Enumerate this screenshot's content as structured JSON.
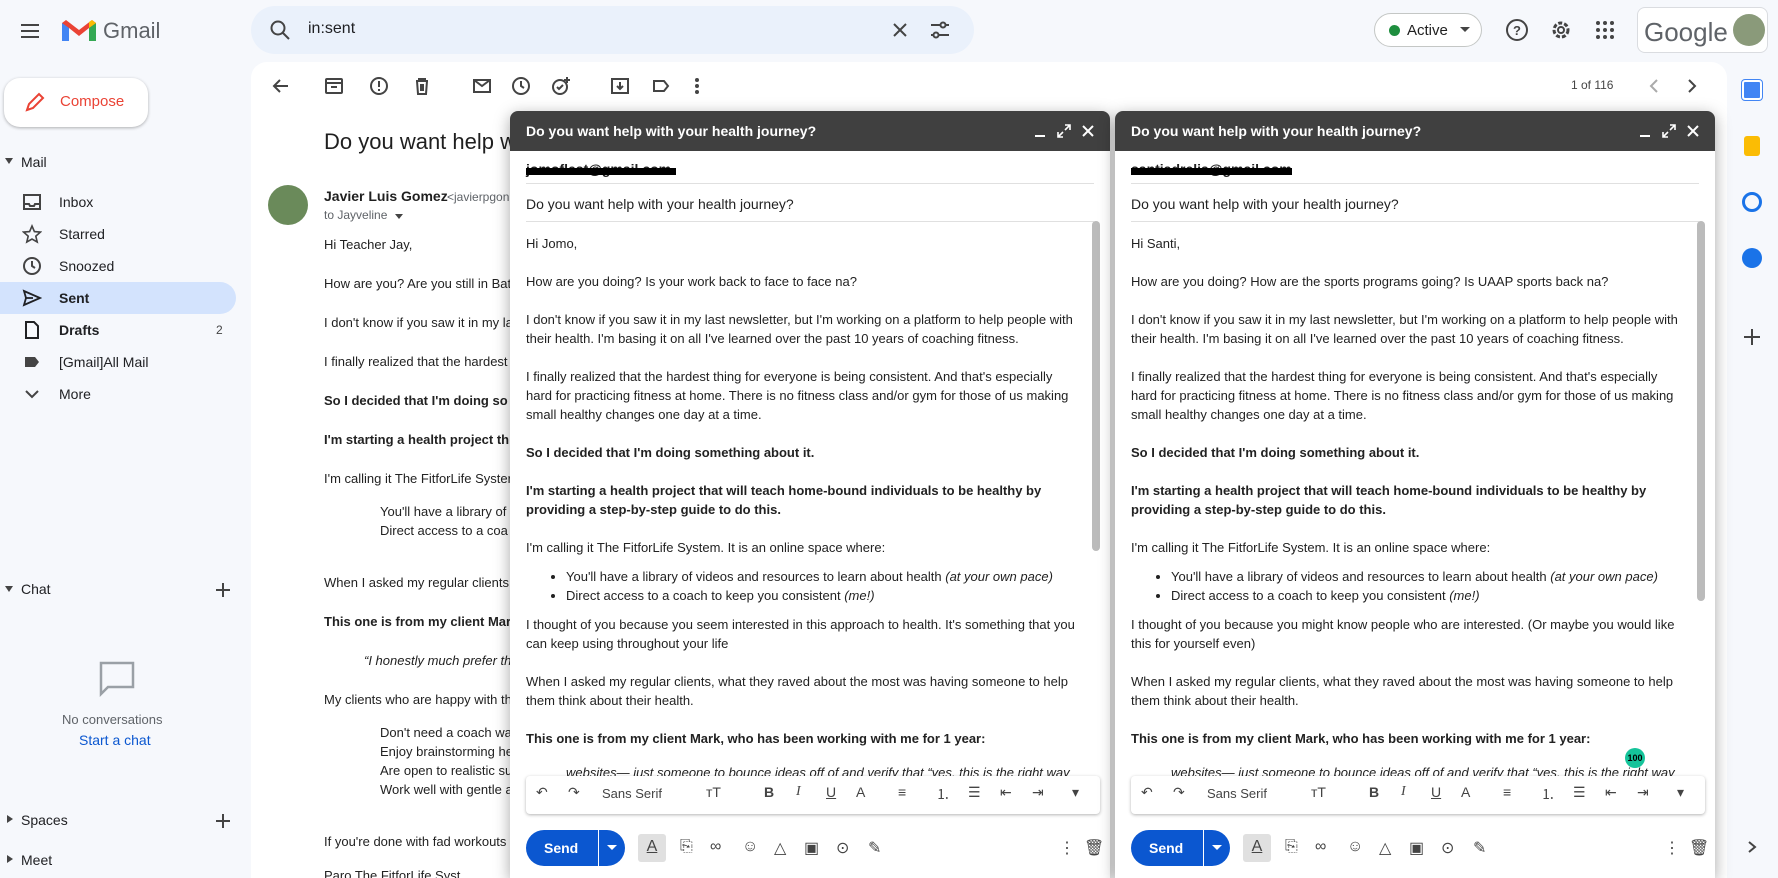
{
  "app": {
    "logo_text": "Gmail",
    "google_text": "Google"
  },
  "search": {
    "query": "in:sent"
  },
  "status": {
    "label": "Active"
  },
  "compose_button": {
    "label": "Compose"
  },
  "sidebar": {
    "mail_section": "Mail",
    "items": [
      {
        "label": "Inbox",
        "count": ""
      },
      {
        "label": "Starred",
        "count": ""
      },
      {
        "label": "Snoozed",
        "count": ""
      },
      {
        "label": "Sent",
        "count": ""
      },
      {
        "label": "Drafts",
        "count": "2"
      },
      {
        "label": "[Gmail]All Mail",
        "count": ""
      },
      {
        "label": "More",
        "count": ""
      }
    ],
    "chat_section": "Chat",
    "no_conversations": "No conversations",
    "start_chat": "Start a chat",
    "spaces_section": "Spaces",
    "meet_section": "Meet"
  },
  "pager": {
    "text": "1 of 116"
  },
  "thread": {
    "subject": "Do you want help w",
    "sender_name": "Javier Luis Gomez",
    "sender_email": "<javierpgon",
    "to_line": "to Jayveline",
    "lines": [
      "Hi Teacher Jay,",
      "How are you? Are you still in Bat",
      "I don't know if you saw it in my la",
      "I finally realized that the hardest",
      "So I decided that I'm doing so",
      "I'm starting a health project th",
      "I'm calling it The FitforLife Syster",
      "You'll have a library of",
      "Direct access to a coa",
      "When I asked my regular clients",
      "This one is from my client Mar",
      "“I honestly much prefer th",
      "My clients who are happy with th",
      "Don't need a coach wa",
      "Enjoy brainstorming he",
      "Are open to realistic su",
      "Work well with gentle a",
      "If you're done with fad workouts",
      "Paro The FitforLife Syst"
    ]
  },
  "compose_left": {
    "title": "Do you want help with your health journey?",
    "to": "jomoflest@gmail.com",
    "subject": "Do you want help with your health journey?",
    "greeting": "Hi Jomo,",
    "p1": "How are you doing? Is your work back to face to face na?",
    "p2a": "I don't know if you saw it in my last newsletter, but I'm working on a platform to help people with",
    "p2b": "their health. I'm basing it on all I've learned over the past 10 years of coaching fitness.",
    "p3a": "I finally realized that the hardest thing for everyone is being consistent. And that's especially",
    "p3b": "hard for practicing fitness at home. There is no fitness class and/or gym for those of us making",
    "p3c": "small healthy changes one day at a time.",
    "b1": "So I decided that I'm doing something about it.",
    "b2a": "I'm starting a health project that will teach home-bound individuals to be healthy by",
    "b2b": "providing a step-by-step guide to do this.",
    "p4": "I'm calling it The FitforLife System. It is an online space where:",
    "li1": "You'll have a library of videos and resources to learn about health ",
    "li1i": "(at your own pace)",
    "li2": "Direct access to a coach to keep you consistent ",
    "li2i": "(me!)",
    "p5a": "I thought of you because you seem interested in this approach to health. It's something that you",
    "p5b": "can keep using throughout your life",
    "p6a": "When I asked my regular clients, what they raved about the most was having someone to help",
    "p6b": "them think about their health.",
    "b3": "This one is from my client Mark, who has been working with me for 1 year:",
    "quote": "websites— just someone to bounce ideas off of and verify that “yes, this is the right way",
    "send": "Send",
    "font": "Sans Serif"
  },
  "compose_right": {
    "title": "Do you want help with your health journey?",
    "to": "santiadrelia@gmail.com",
    "subject": "Do you want help with your health journey?",
    "greeting": "Hi Santi,",
    "p1": "How are you doing? How are the sports programs going? Is UAAP sports back na?",
    "p2a": "I don't know if you saw it in my last newsletter, but I'm working on a platform to help people with",
    "p2b": "their health. I'm basing it on all I've learned over the past 10 years of coaching fitness.",
    "p3a": "I finally realized that the hardest thing for everyone is being consistent. And that's especially",
    "p3b": "hard for practicing fitness at home. There is no fitness class and/or gym for those of us making",
    "p3c": "small healthy changes one day at a time.",
    "b1": "So I decided that I'm doing something about it.",
    "b2a": "I'm starting a health project that will teach home-bound individuals to be healthy by",
    "b2b": "providing a step-by-step guide to do this.",
    "p4": "I'm calling it The FitforLife System. It is an online space where:",
    "li1": "You'll have a library of videos and resources to learn about health ",
    "li1i": "(at your own pace)",
    "li2": "Direct access to a coach to keep you consistent ",
    "li2i": "(me!)",
    "p5a": "I thought of you because you might know people who are interested. (Or maybe you would like",
    "p5b": "this for yourself even)",
    "p6a": "When I asked my regular clients, what they raved about the most was having someone to help",
    "p6b": "them think about their health.",
    "b3": "This one is from my client Mark, who has been working with me for 1 year:",
    "quote": "websites— just someone to bounce ideas off of and verify that “yes, this is the right way",
    "send": "Send",
    "font": "Sans Serif",
    "badge": "100"
  },
  "colors": {
    "accent": "#0b57d0",
    "compose_header": "#404040",
    "selected": "#d3e3fd",
    "sidebar_bg": "#f6f8fc"
  }
}
